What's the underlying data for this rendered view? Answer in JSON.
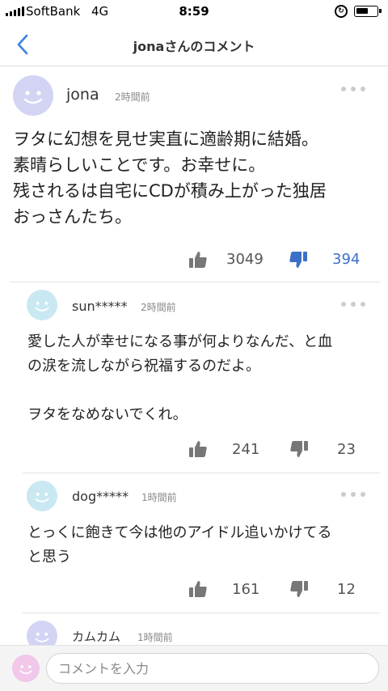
{
  "status_bar": {
    "carrier": "SoftBank",
    "network": "4G",
    "time": "8:59"
  },
  "nav": {
    "title": "jonaさんのコメント"
  },
  "comments": [
    {
      "author": "jona",
      "time": "2時間前",
      "lines": [
        "ヲタに幻想を見せ実直に適齢期に結婚。",
        "素晴らしいことです。お幸せに。",
        "残されるは自宅にCDが積み上がった独居",
        "おっさんたち。"
      ],
      "likes": "3049",
      "dislikes": "394",
      "disliked": true
    },
    {
      "author": "sun*****",
      "time": "2時間前",
      "lines": [
        "愛した人が幸せになる事が何よりなんだ、と血",
        "の涙を流しながら祝福するのだよ。",
        "",
        "ヲタをなめないでくれ。"
      ],
      "likes": "241",
      "dislikes": "23"
    },
    {
      "author": "dog*****",
      "time": "1時間前",
      "lines": [
        "とっくに飽きて今は他のアイドル追いかけてる",
        "と思う"
      ],
      "likes": "161",
      "dislikes": "12"
    },
    {
      "author": "カムカム",
      "time": "1時間前"
    }
  ],
  "input": {
    "placeholder": "コメントを入力"
  },
  "colors": {
    "accent": "#3b70c8",
    "avatar_main": "#d3d3f3",
    "avatar_reply": "#c9e8f2",
    "avatar_user": "#f1c7ea"
  }
}
